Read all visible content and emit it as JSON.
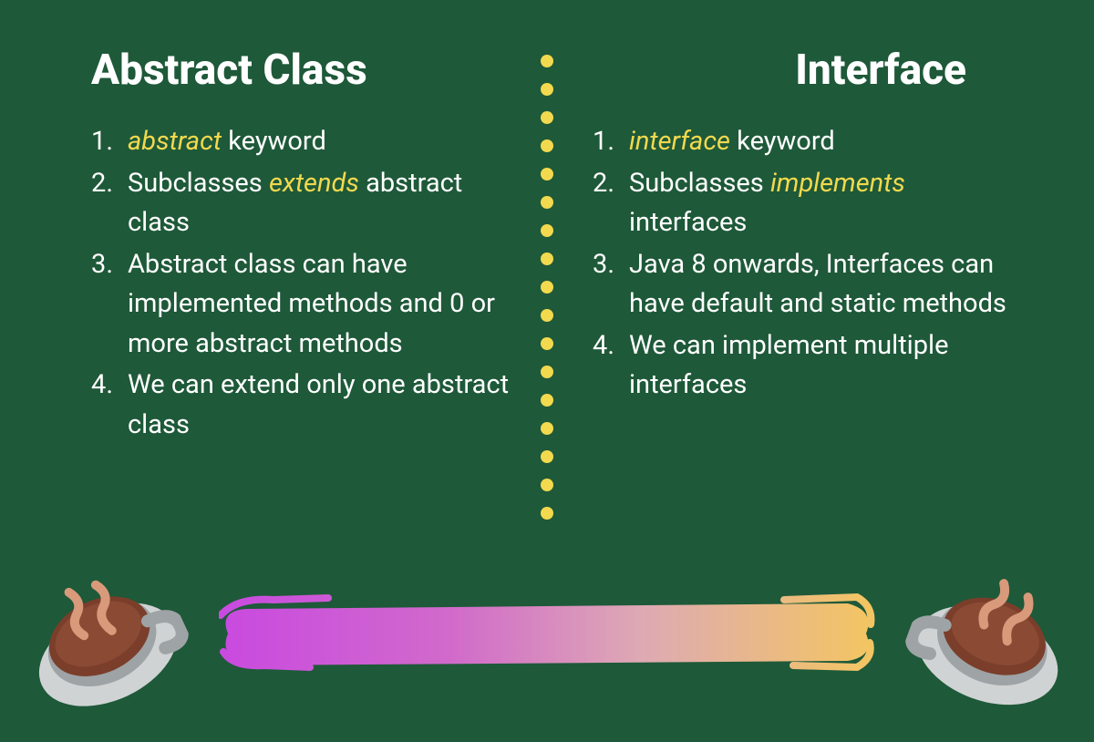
{
  "left": {
    "title": "Abstract Class",
    "items": [
      {
        "pre": "",
        "kw": "abstract",
        "post": " keyword"
      },
      {
        "pre": "Subclasses ",
        "kw": "extends",
        "post": " abstract class"
      },
      {
        "pre": "Abstract class can have implemented methods and 0 or more abstract methods",
        "kw": "",
        "post": ""
      },
      {
        "pre": "We can extend only one abstract class",
        "kw": "",
        "post": ""
      }
    ]
  },
  "right": {
    "title": "Interface",
    "items": [
      {
        "pre": "",
        "kw": "interface",
        "post": " keyword"
      },
      {
        "pre": "Subclasses ",
        "kw": "implements",
        "post": " interfaces"
      },
      {
        "pre": "Java 8 onwards, Interfaces can have default and static methods",
        "kw": "",
        "post": ""
      },
      {
        "pre": "We can implement multiple interfaces",
        "kw": "",
        "post": ""
      }
    ]
  },
  "dividerDots": 17
}
